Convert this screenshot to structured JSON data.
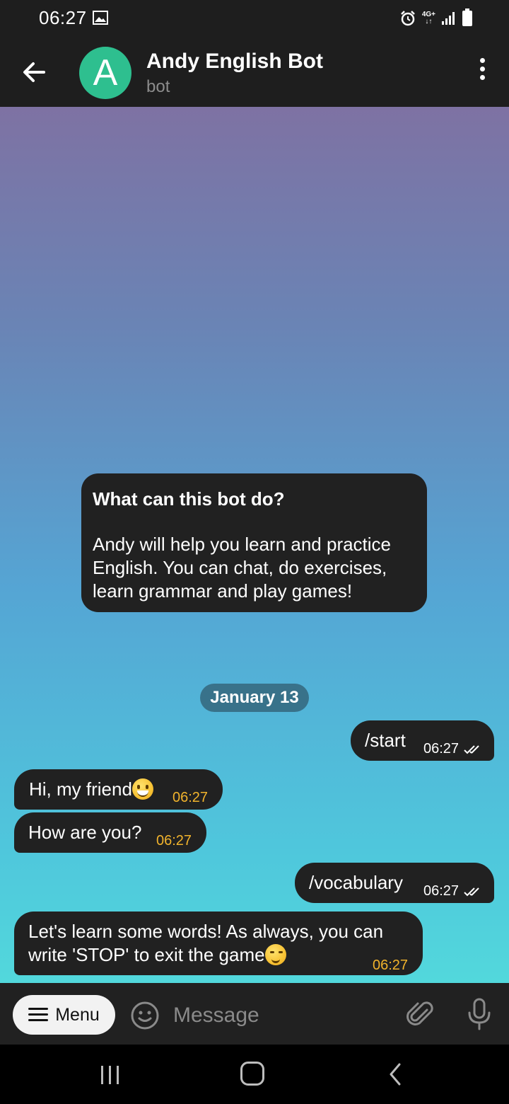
{
  "status_bar": {
    "time": "06:27",
    "network": "4G+"
  },
  "header": {
    "title": "Andy English Bot",
    "subtitle": "bot",
    "avatar_letter": "A",
    "avatar_color": "#2ebf8f"
  },
  "intro_card": {
    "title": "What can this bot do?",
    "body": "Andy will help you learn and practice English. You can chat, do exercises, learn grammar and play games!"
  },
  "date_separator": "January 13",
  "messages": [
    {
      "direction": "out",
      "text": "/start",
      "time": "06:27",
      "status": "read"
    },
    {
      "direction": "in",
      "text": "Hi, my friend",
      "emoji": "grinning-face",
      "time": "06:27"
    },
    {
      "direction": "in",
      "text": "How are you?",
      "time": "06:27"
    },
    {
      "direction": "out",
      "text": "/vocabulary",
      "time": "06:27",
      "status": "read"
    },
    {
      "direction": "in",
      "text_line1": "Let's learn some words! As always, you can",
      "text_line2": "write 'STOP' to exit the game",
      "emoji": "winking-face",
      "time": "06:27"
    }
  ],
  "input_bar": {
    "menu_label": "Menu",
    "placeholder": "Message"
  },
  "colors": {
    "bubble": "#212121",
    "incoming_time": "#f1b32c",
    "header_bg": "#1e1e1e"
  }
}
